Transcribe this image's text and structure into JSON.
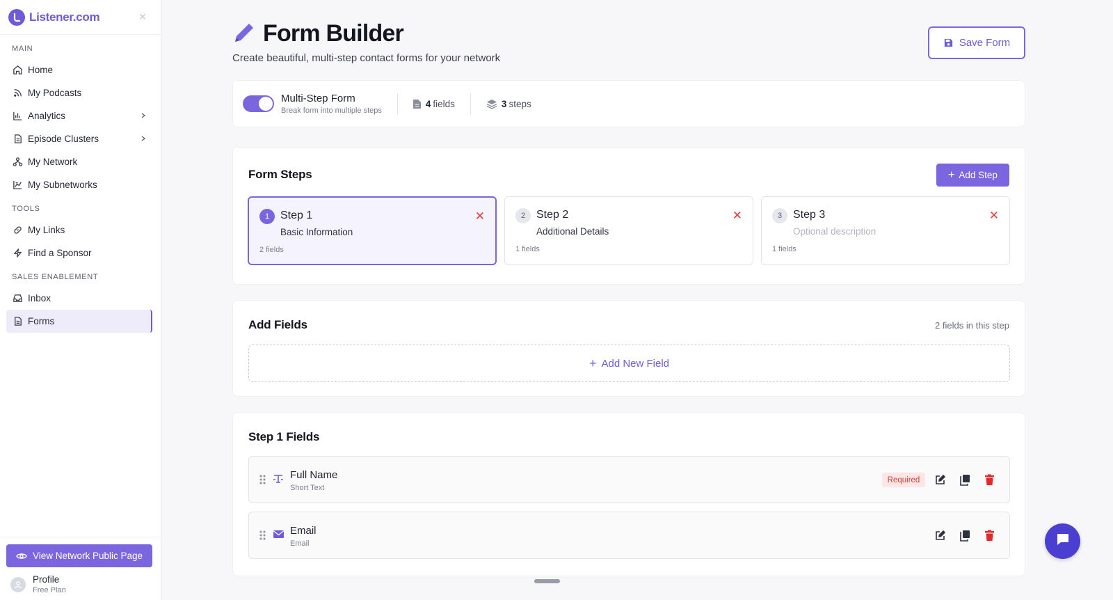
{
  "brand": {
    "name": "Listener.com",
    "icon": "listener-logo-icon",
    "color": "#6e5bd8"
  },
  "sidebar": {
    "sections": [
      {
        "label": "MAIN",
        "items": [
          {
            "label": "Home",
            "icon": "home-icon"
          },
          {
            "label": "My Podcasts",
            "icon": "rss-icon"
          },
          {
            "label": "Analytics",
            "icon": "bar-chart-icon",
            "has_submenu": true
          },
          {
            "label": "Episode Clusters",
            "icon": "document-icon",
            "has_submenu": true
          },
          {
            "label": "My Network",
            "icon": "network-icon"
          },
          {
            "label": "My Subnetworks",
            "icon": "subnetwork-icon"
          }
        ]
      },
      {
        "label": "TOOLS",
        "items": [
          {
            "label": "My Links",
            "icon": "link-icon"
          },
          {
            "label": "Find a Sponsor",
            "icon": "lightning-icon"
          }
        ]
      },
      {
        "label": "SALES ENABLEMENT",
        "items": [
          {
            "label": "Inbox",
            "icon": "inbox-icon"
          },
          {
            "label": "Forms",
            "icon": "form-icon",
            "active": true
          }
        ]
      }
    ],
    "view_button": "View Network Public Page",
    "profile": {
      "name": "Profile",
      "plan": "Free Plan"
    }
  },
  "header": {
    "title": "Form Builder",
    "subtitle": "Create beautiful, multi-step contact forms for your network",
    "save_label": "Save Form"
  },
  "settings": {
    "toggle_title": "Multi-Step Form",
    "toggle_subtitle": "Break form into multiple steps",
    "toggle_on": true,
    "fields_count": "4",
    "fields_label": "fields",
    "steps_count": "3",
    "steps_label": "steps"
  },
  "form_steps": {
    "title": "Form Steps",
    "add_label": "Add Step",
    "steps": [
      {
        "num": "1",
        "name": "Step 1",
        "desc": "Basic Information",
        "count": "2 fields",
        "active": true
      },
      {
        "num": "2",
        "name": "Step 2",
        "desc": "Additional Details",
        "count": "1 fields"
      },
      {
        "num": "3",
        "name": "Step 3",
        "desc": "Optional description",
        "count": "1 fields",
        "placeholder": true
      }
    ]
  },
  "add_fields": {
    "title": "Add Fields",
    "count_label": "2 fields in this step",
    "add_label": "Add New Field"
  },
  "step_fields": {
    "title": "Step 1 Fields",
    "fields": [
      {
        "name": "Full Name",
        "type": "Short Text",
        "icon": "text-cursor-icon",
        "required": true,
        "badge": "Required"
      },
      {
        "name": "Email",
        "type": "Email",
        "icon": "envelope-icon",
        "required": false
      }
    ]
  },
  "colors": {
    "accent": "#7c66e0",
    "danger": "#e53a3a",
    "chat": "#4a3fd0"
  }
}
